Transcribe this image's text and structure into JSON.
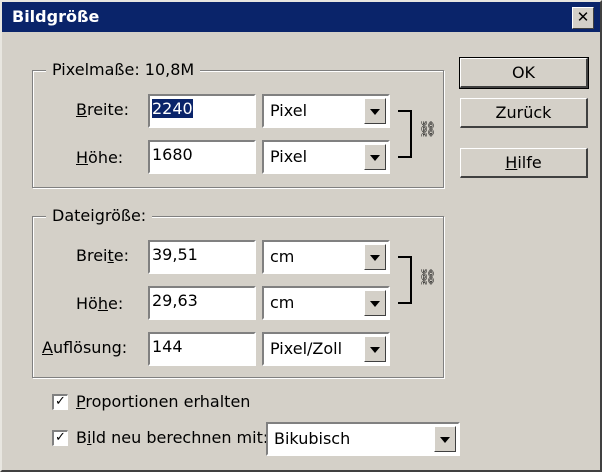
{
  "window": {
    "title": "Bildgröße",
    "close_glyph": "✕"
  },
  "pixel_dimensions": {
    "legend": "Pixelmaße: 10,8M",
    "width_label": {
      "pre": "",
      "key": "B",
      "post": "reite:"
    },
    "width_value": "2240",
    "width_unit": "Pixel",
    "height_label": {
      "pre": "",
      "key": "H",
      "post": "öhe:"
    },
    "height_value": "1680",
    "height_unit": "Pixel"
  },
  "document_size": {
    "legend": "Dateigröße:",
    "width_label": {
      "pre": "Brei",
      "key": "t",
      "post": "e:"
    },
    "width_value": "39,51",
    "width_unit": "cm",
    "height_label": {
      "pre": "Hö",
      "key": "h",
      "post": "e:"
    },
    "height_value": "29,63",
    "height_unit": "cm",
    "resolution_label": {
      "pre": "",
      "key": "A",
      "post": "uflösung:"
    },
    "resolution_value": "144",
    "resolution_unit": "Pixel/Zoll"
  },
  "buttons": {
    "ok": "OK",
    "reset": "Zurück",
    "help": {
      "key": "H",
      "post": "ilfe"
    }
  },
  "options": {
    "constrain": {
      "checked_glyph": "✓",
      "key": "P",
      "post": "roportionen erhalten"
    },
    "resample": {
      "checked_glyph": "✓",
      "pre": "B",
      "key": "i",
      "post": "ld neu berechnen mit:",
      "method": "Bikubisch"
    }
  },
  "icons": {
    "link": "chain-link-icon"
  }
}
